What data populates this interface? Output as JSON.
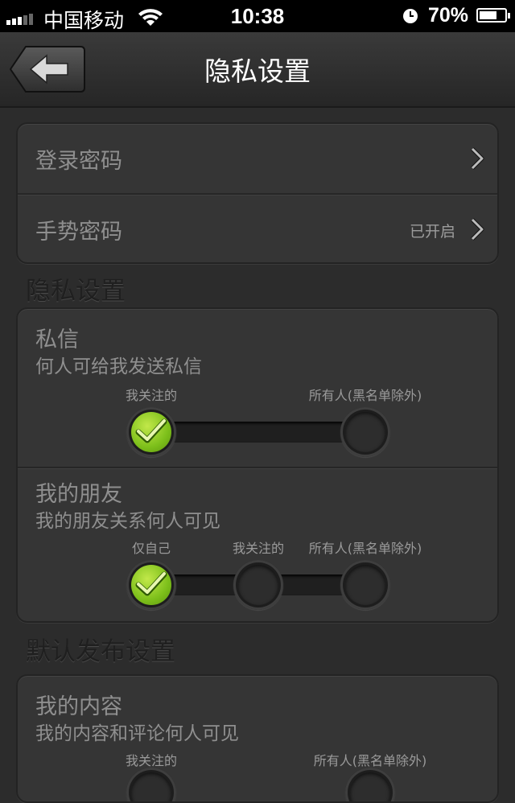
{
  "status_bar": {
    "carrier": "中国移动",
    "time": "10:38",
    "battery": "70%",
    "battery_level": 0.7
  },
  "nav": {
    "title": "隐私设置"
  },
  "security": {
    "login_password": {
      "label": "登录密码"
    },
    "gesture_password": {
      "label": "手势密码",
      "value": "已开启"
    }
  },
  "privacy_section": {
    "title": "隐私设置",
    "messages": {
      "title": "私信",
      "subtitle": "何人可给我发送私信",
      "options": [
        "我关注的",
        "所有人(黑名单除外)"
      ],
      "selected": 0
    },
    "friends": {
      "title": "我的朋友",
      "subtitle": "我的朋友关系何人可见",
      "options": [
        "仅自己",
        "我关注的",
        "所有人(黑名单除外)"
      ],
      "selected": 0
    }
  },
  "publish_section": {
    "title": "默认发布设置",
    "content": {
      "title": "我的内容",
      "subtitle": "我的内容和评论何人可见",
      "options": [
        "我关注的",
        "所有人(黑名单除外)"
      ]
    }
  }
}
